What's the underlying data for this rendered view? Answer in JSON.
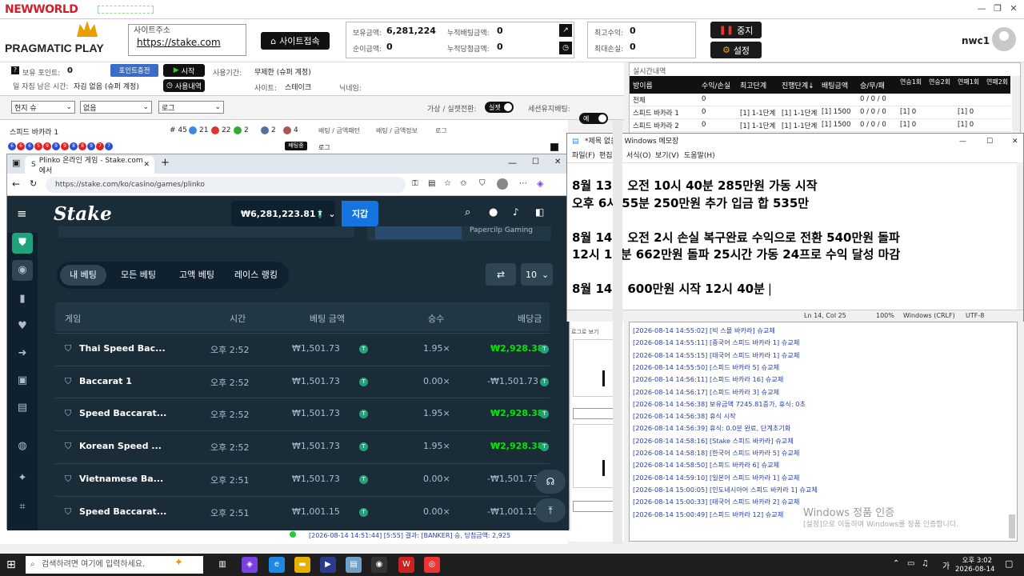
{
  "app": {
    "brand": "NEWWORLD",
    "user": "nwc1"
  },
  "header": {
    "provider_logo": "PRAGMATIC PLAY",
    "site_label": "사이트주소",
    "site_url": "https://stake.com",
    "connect_btn": "사이트접속",
    "holding_label": "보유금액:",
    "holding_value": "6,281,224",
    "acc_bet_label": "누적배팅금액:",
    "acc_bet_value": "0",
    "profit_label": "순이금액:",
    "profit_value": "0",
    "acc_win_label": "누적당첨금액:",
    "acc_win_value": "0",
    "max_profit_label": "최고수익:",
    "max_profit_value": "0",
    "max_loss_label": "최대손실:",
    "max_loss_value": "0",
    "stop_btn": "중지",
    "settings_btn": "설정"
  },
  "row2": {
    "points_label": "보유 포인트:",
    "points_value": "0",
    "points_btn": "포인트충전",
    "start_btn": "시작",
    "period_label": "사용기간:",
    "period_value": "무제한 (슈퍼 계정)",
    "remain_label": "일 자짐 남은 시간:",
    "remain_value": "자김 없음 (슈퍼 계정)",
    "history_btn": "사용내역",
    "site_label": "사이트:",
    "site_value": "스테이크",
    "nick_label": "닉네임:"
  },
  "row3": {
    "sel1": "현지 슈",
    "sel2": "없음",
    "sel3": "로그",
    "virtual_label": "가상 / 실젯전환:",
    "virtual_toggle": "실젯",
    "session_label": "세션유지배팅:",
    "session_toggle": "예"
  },
  "live": {
    "title": "실시간내역",
    "headers": [
      "방이름",
      "수익/손실",
      "최고단계",
      "진행단계↓",
      "배팅금액",
      "승/무/패",
      "연승1회",
      "연승2회",
      "연패1회",
      "연패2회"
    ],
    "rows": [
      [
        "전체",
        "0",
        "",
        "",
        "",
        "0 / 0 / 0",
        "",
        "",
        "",
        ""
      ],
      [
        "스피드 바카라 1",
        "0",
        "[1] 1-1단계",
        "[1] 1-1단계",
        "[1] 1500",
        "0 / 0 / 0",
        "[1] 0",
        "",
        "[1] 0",
        ""
      ],
      [
        "스피드 바카라 2",
        "0",
        "[1] 1-1단계",
        "[1] 1-1단계",
        "[1] 1500",
        "0 / 0 / 0",
        "[1] 0",
        "",
        "[1] 0",
        ""
      ]
    ]
  },
  "road": {
    "room": "스피드 바카라 1",
    "count": "# 45",
    "p": "21",
    "b": "22",
    "t": "2",
    "pp": "2",
    "bp": "4",
    "tab1": "배팅 / 금액패턴",
    "tab2": "배팅 / 금액정보",
    "tab3": "로그",
    "bet_badge": "배팅중",
    "log": "로그"
  },
  "browser": {
    "tab_title": "Plinko 온라인 게임 - Stake.com에서",
    "url": "https://stake.com/ko/casino/games/plinko",
    "balance": "₩6,281,223.81",
    "wallet_btn": "지갑",
    "promo": "Papercilp Gaming",
    "tabs": [
      "내 베팅",
      "모든 베팅",
      "고액 베팅",
      "레이스 랭킹"
    ],
    "page_size": "10",
    "columns": [
      "게임",
      "시간",
      "베팅 금액",
      "승수",
      "배당금"
    ],
    "rows": [
      {
        "game": "Thai Speed Bac...",
        "time": "오후 2:52",
        "amount": "₩1,501.73",
        "mult": "1.95×",
        "payout": "₩2,928.38",
        "win": true
      },
      {
        "game": "Baccarat 1",
        "time": "오후 2:52",
        "amount": "₩1,501.73",
        "mult": "0.00×",
        "payout": "-₩1,501.73",
        "win": false
      },
      {
        "game": "Speed Baccarat...",
        "time": "오후 2:52",
        "amount": "₩1,501.73",
        "mult": "1.95×",
        "payout": "₩2,928.38",
        "win": true
      },
      {
        "game": "Korean Speed ...",
        "time": "오후 2:52",
        "amount": "₩1,501.73",
        "mult": "1.95×",
        "payout": "₩2,928.38",
        "win": true
      },
      {
        "game": "Vietnamese Ba...",
        "time": "오후 2:51",
        "amount": "₩1,501.73",
        "mult": "0.00×",
        "payout": "-₩1,501.73",
        "win": false
      },
      {
        "game": "Speed Baccarat...",
        "time": "오후 2:51",
        "amount": "₩1,001.15",
        "mult": "0.00×",
        "payout": "-₩1,001.15",
        "win": false
      }
    ]
  },
  "notepad": {
    "title": "*제목 없음 - Windows 메모장",
    "menu": [
      "파일(F)",
      "편집(E)",
      "서식(O)",
      "보기(V)",
      "도움말(H)"
    ],
    "lines": [
      "8월 13일 오전 10시 40분 285만원 가동 시작",
      "오후 6시 55분 250만원 추가 입금 합 535만",
      "",
      "8월 14일 오전 2시 손실 복구완료 수익으로 전환 540만원 돌파",
      "12시 12분 662만원 돌파 25시간 가동 24프로 수익 달성 마감",
      "",
      "8월 14일 600만원 시작 12시 40분"
    ],
    "status_pos": "Ln 14, Col 25",
    "status_zoom": "100%",
    "status_eol": "Windows (CRLF)",
    "status_enc": "UTF-8"
  },
  "log": {
    "lines": [
      "[2026-08-14 14:55:02] [빅 스몰 바카라] 슈교체",
      "[2026-08-14 14:55:11] [중국어 스피드 바카라 1] 슈교체",
      "[2026-08-14 14:55:15] [태국어 스피드 바카라 1] 슈교체",
      "[2026-08-14 14:55:50] [스피드 바카라 5] 슈교체",
      "[2026-08-14 14:56:11] [스피드 바카라 16] 슈교체",
      "[2026-08-14 14:56:17] [스피드 바카라 3] 슈교체",
      "[2026-08-14 14:56:38] 보유금액 7245.81증가, 휴식: 0초",
      "[2026-08-14 14:56:38] 휴식 시작",
      "[2026-08-14 14:56:39] 휴식: 0.0분 완료, 단계초기화",
      "[2026-08-14 14:58:16] [Stake 스피드 바카라] 슈교체",
      "[2026-08-14 14:58:18] [한국어 스피드 바카라 5] 슈교체",
      "[2026-08-14 14:58:50] [스피드 바카라 6] 슈교체",
      "[2026-08-14 14:59:10] [일본어 스피드 바카라 1] 슈교체",
      "[2026-08-14 15:00:05] [인도네시아어 스피드 바카라 1] 슈교체",
      "[2026-08-14 15:00:33] [태국어 스피드 바카라 2] 슈교체",
      "[2026-08-14 15:00:49] [스피드 바카라 12] 슈교체"
    ],
    "bottom_line": "[2026-08-14 14:51:44] [5:55] 결과: [BANKER] 승, 당첨금액: 2,925",
    "view_btn": "로그로 보기"
  },
  "watermark": {
    "title": "Windows 정품 인증",
    "sub": "[설정]으로 이동하여 Windows를 정품 인증합니다."
  },
  "taskbar": {
    "search": "검색하려면 여기에 입력하세요.",
    "time": "오후 3:02",
    "date": "2026-08-14",
    "lang": "가"
  }
}
